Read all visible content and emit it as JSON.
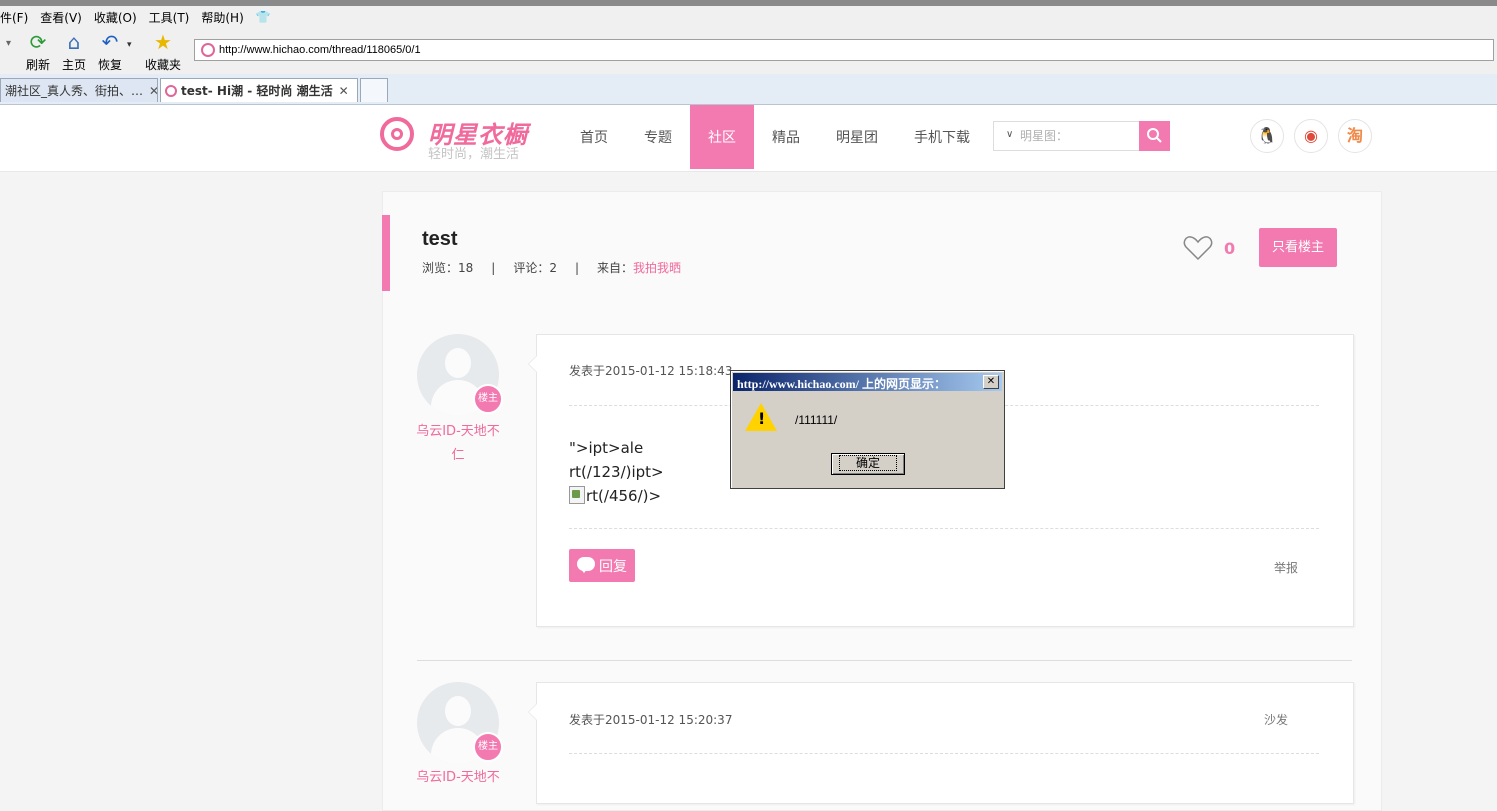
{
  "browser": {
    "menu": [
      "件(F)",
      "查看(V)",
      "收藏(O)",
      "工具(T)",
      "帮助(H)"
    ],
    "toolbar": {
      "refresh_label": "刷新",
      "home_label": "主页",
      "restore_label": "恢复",
      "favorites_label": "收藏夹"
    },
    "address": "http://www.hichao.com/thread/118065/0/1",
    "tabs": [
      {
        "label": "潮社区_真人秀、街拍、…",
        "active": false
      },
      {
        "label": "test- Hi潮 - 轻时尚 潮生活",
        "active": true
      }
    ]
  },
  "site": {
    "logo_name": "明星衣橱",
    "logo_slogan": "轻时尚，潮生活",
    "nav": [
      "首页",
      "专题",
      "社区",
      "精品",
      "明星团",
      "手机下载"
    ],
    "active_nav": "社区",
    "search_placeholder": "明星图：",
    "accent_color": "#f37ab0"
  },
  "thread": {
    "title": "test",
    "views_label": "浏览：18",
    "comments_label": "评论：2",
    "from_label": "来自：",
    "from_value": "我拍我晒",
    "like_count": "0",
    "only_op_label": "只看楼主"
  },
  "posts": [
    {
      "author": "乌云ID-天地不仁",
      "badge": "楼主",
      "time": "发表于2015-01-12 15:18:43",
      "body_lines": [
        "\">ipt>ale",
        "rt(/123/)ipt>",
        "rt(/456/)>"
      ],
      "reply_label": "回复",
      "report_label": "举报"
    },
    {
      "author": "乌云ID-天地不",
      "badge": "楼主",
      "time": "发表于2015-01-12 15:20:37",
      "floor": "沙发"
    }
  ],
  "dialog": {
    "title": "http://www.hichao.com/ 上的网页显示：",
    "message": "/111111/",
    "ok_label": "确定"
  }
}
